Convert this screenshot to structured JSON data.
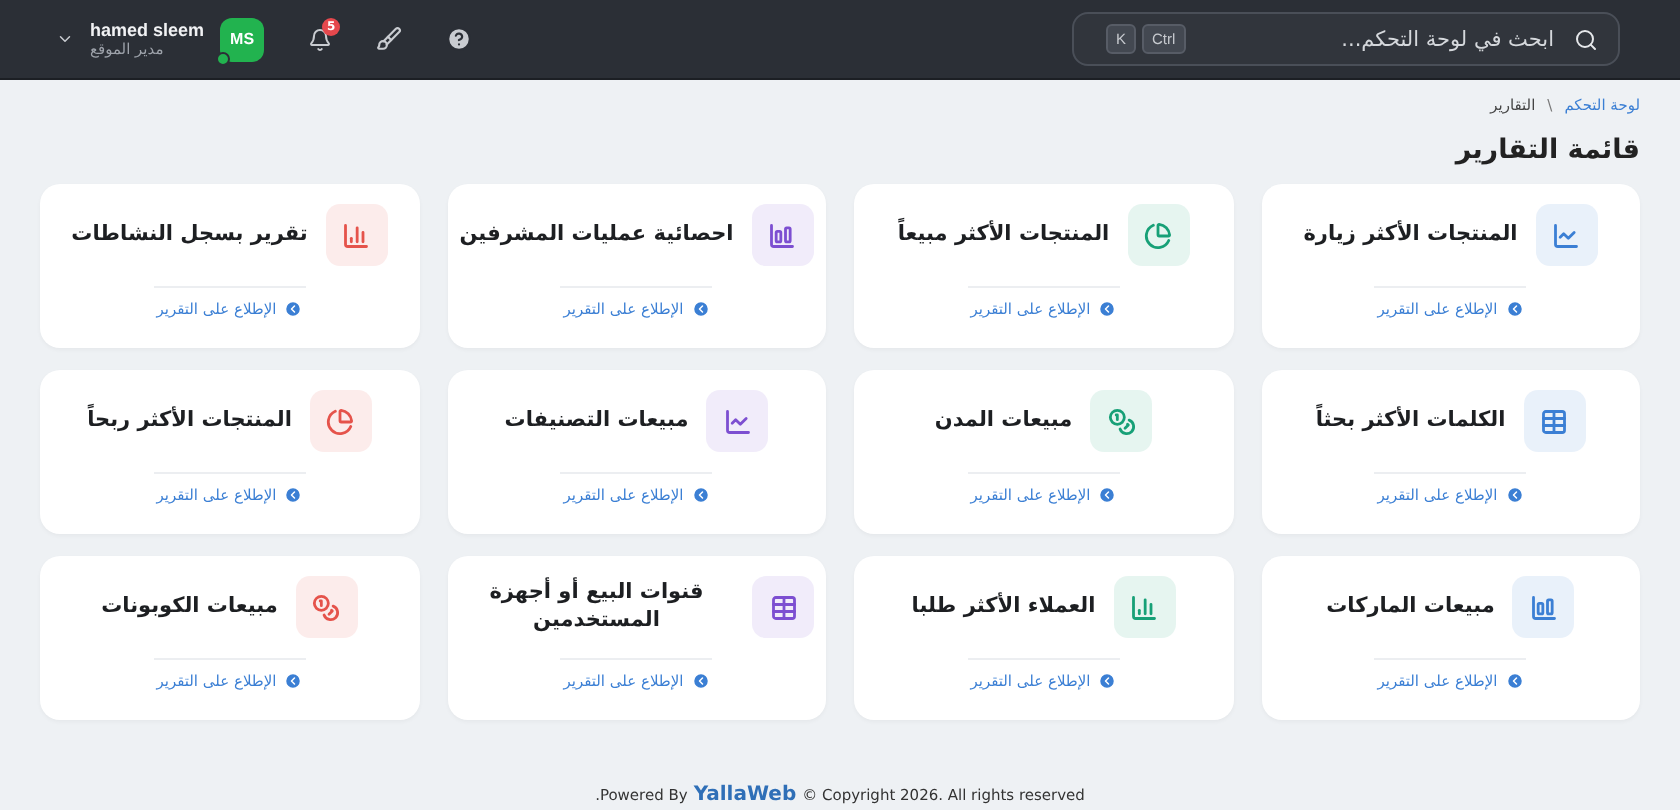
{
  "header": {
    "search": {
      "placeholder": "ابحث في لوحة التحكم...",
      "keys": [
        "Ctrl",
        "K"
      ]
    },
    "user": {
      "name": "hamed sleem",
      "role": "مدير الموقع",
      "initials": "MS",
      "online": true
    },
    "notifications": {
      "badge": "5"
    }
  },
  "breadcrumb": [
    {
      "label": "لوحة التحكم",
      "kind": "link"
    },
    {
      "label": "\\",
      "kind": "separator"
    },
    {
      "label": "التقارير",
      "kind": "current"
    }
  ],
  "page_title": "قائمة التقارير",
  "reports": [
    {
      "title": "المنتجات الأكثر زيارة",
      "kind": "line",
      "color": "#3b7fd4",
      "link": "الإطلاع على التقرير"
    },
    {
      "title": "المنتجات الأكثر مبيعاً",
      "kind": "pie",
      "color": "#17a077",
      "link": "الإطلاع على التقرير"
    },
    {
      "title": "احصائية عمليات المشرفين",
      "kind": "bars",
      "color": "#7d4fd1",
      "link": "الإطلاع على التقرير"
    },
    {
      "title": "تقرير بسجل النشاطات",
      "kind": "columns",
      "color": "#e5534b",
      "link": "الإطلاع على التقرير"
    },
    {
      "title": "الكلمات الأكثر بحثاً",
      "kind": "table",
      "color": "#3b7fd4",
      "link": "الإطلاع على التقرير"
    },
    {
      "title": "مبيعات المدن",
      "kind": "coins",
      "color": "#17a077",
      "link": "الإطلاع على التقرير"
    },
    {
      "title": "مبيعات التصنيفات",
      "kind": "line",
      "color": "#7d4fd1",
      "link": "الإطلاع على التقرير"
    },
    {
      "title": "المنتجات الأكثر ربحاً",
      "kind": "pie",
      "color": "#e5534b",
      "link": "الإطلاع على التقرير"
    },
    {
      "title": "مبيعات الماركات",
      "kind": "bars",
      "color": "#3b7fd4",
      "link": "الإطلاع على التقرير"
    },
    {
      "title": "العملاء الأكثر طلبا",
      "kind": "columns",
      "color": "#17a077",
      "link": "الإطلاع على التقرير"
    },
    {
      "title": "قنوات البيع أو أجهزة المستخدمين",
      "kind": "table",
      "color": "#7d4fd1",
      "link": "الإطلاع على التقرير"
    },
    {
      "title": "مبيعات الكوبونات",
      "kind": "coins",
      "color": "#e5534b",
      "link": "الإطلاع على التقرير"
    }
  ],
  "footer": {
    "prefix": ".Powered By",
    "brand": "YallaWeb",
    "suffix": "© Copyright 2026. All rights reserved"
  }
}
